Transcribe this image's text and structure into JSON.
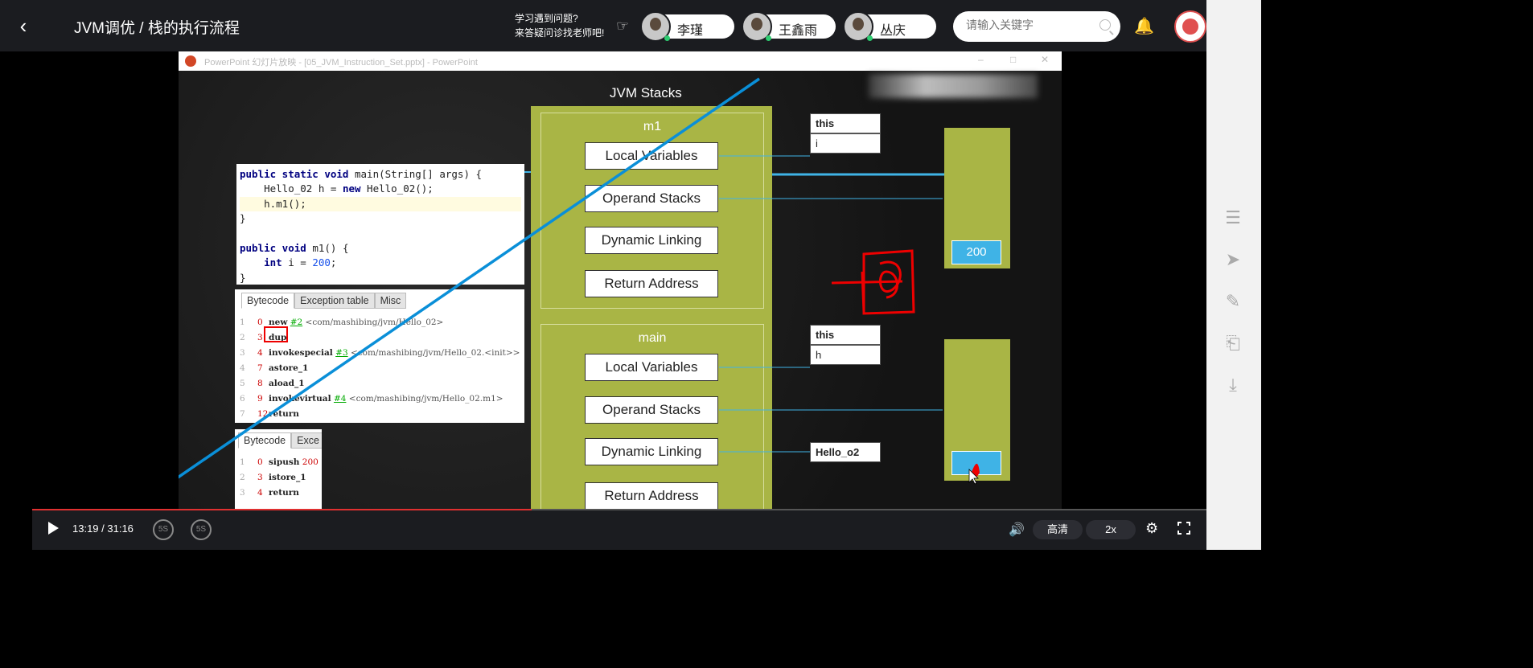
{
  "header": {
    "back_icon": "chevron-left-icon",
    "title": "JVM调优 / 栈的执行流程",
    "qa_line1": "学习遇到问题?",
    "qa_line2": "来答疑问诊找老师吧!",
    "teachers": [
      "李瑾",
      "王鑫雨",
      "丛庆"
    ],
    "search_placeholder": "请输入关键字"
  },
  "ppt_window": {
    "title": "PowerPoint 幻灯片放映 - [05_JVM_Instruction_Set.pptx] - PowerPoint"
  },
  "slide": {
    "stacks_title": "JVM Stacks",
    "code_lines": [
      "public static void main(String[] args) {",
      "    Hello_02 h = new Hello_02();",
      "    h.m1();",
      "}",
      "",
      "public void m1() {",
      "    int i = 200;",
      "}"
    ],
    "bytecode_tabs": [
      "Bytecode",
      "Exception table",
      "Misc"
    ],
    "bytecode_lines": [
      {
        "ln": "1",
        "off": "0",
        "op": "new",
        "ref": "#2",
        "comment": "<com/mashibing/jvm/Hello_02>"
      },
      {
        "ln": "2",
        "off": "3",
        "op": "dup",
        "ref": "",
        "comment": ""
      },
      {
        "ln": "3",
        "off": "4",
        "op": "invokespecial",
        "ref": "#3",
        "comment": "<com/mashibing/jvm/Hello_02.<init>>"
      },
      {
        "ln": "4",
        "off": "7",
        "op": "astore_1",
        "ref": "",
        "comment": ""
      },
      {
        "ln": "5",
        "off": "8",
        "op": "aload_1",
        "ref": "",
        "comment": ""
      },
      {
        "ln": "6",
        "off": "9",
        "op": "invokevirtual",
        "ref": "#4",
        "comment": "<com/mashibing/jvm/Hello_02.m1>"
      },
      {
        "ln": "7",
        "off": "12",
        "op": "return",
        "ref": "",
        "comment": ""
      }
    ],
    "bytecode2_tabs": [
      "Bytecode",
      "Exce"
    ],
    "bytecode2_lines": [
      {
        "ln": "1",
        "off": "0",
        "op": "sipush",
        "val": "200"
      },
      {
        "ln": "2",
        "off": "3",
        "op": "istore_1",
        "val": ""
      },
      {
        "ln": "3",
        "off": "4",
        "op": "return",
        "val": ""
      }
    ],
    "frame_m1": {
      "name": "m1",
      "slots": [
        "Local Variables",
        "Operand Stacks",
        "Dynamic Linking",
        "Return Address"
      ],
      "locals": [
        "this",
        "i"
      ],
      "operand_value": "200"
    },
    "frame_main": {
      "name": "main",
      "slots": [
        "Local Variables",
        "Operand Stacks",
        "Dynamic Linking",
        "Return Address"
      ],
      "locals": [
        "this",
        "h"
      ],
      "dynamic_link": "Hello_o2"
    }
  },
  "player": {
    "time": "13:19 / 31:16",
    "progress": 0.425,
    "rewind_label": "5S",
    "forward_label": "5S",
    "quality": "高清",
    "speed": "2x"
  },
  "sidebar_icons": [
    "list-icon",
    "send-icon",
    "edit-icon",
    "inbox-icon",
    "download-icon"
  ]
}
